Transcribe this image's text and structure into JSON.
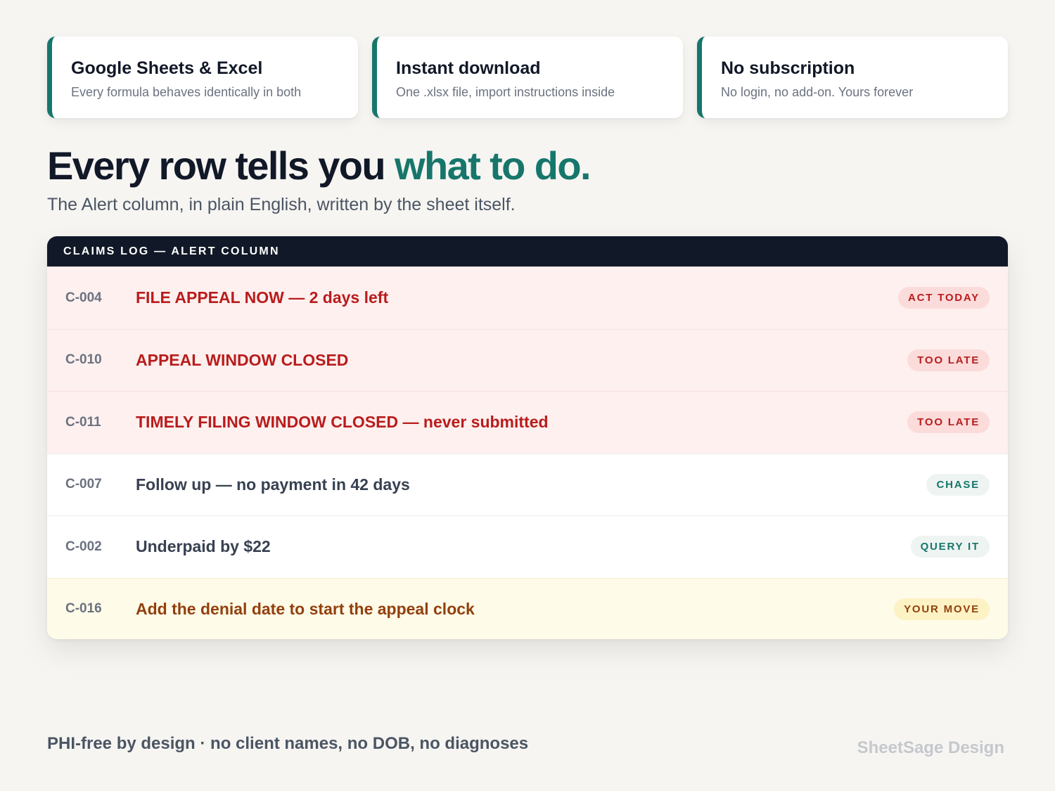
{
  "features": [
    {
      "title": "Google Sheets & Excel",
      "subtitle": "Every formula behaves identically in both"
    },
    {
      "title": "Instant download",
      "subtitle": "One .xlsx file, import instructions inside"
    },
    {
      "title": "No subscription",
      "subtitle": "No login, no add-on. Yours forever"
    }
  ],
  "headline": {
    "lead": "Every row tells you ",
    "accent": "what to do."
  },
  "subheadline": "The Alert column, in plain English, written by the sheet itself.",
  "table": {
    "header": "CLAIMS LOG — ALERT COLUMN",
    "rows": [
      {
        "id": "C-004",
        "message": "FILE APPEAL NOW — 2 days left",
        "badge": "ACT TODAY",
        "status": "danger"
      },
      {
        "id": "C-010",
        "message": "APPEAL WINDOW CLOSED",
        "badge": "TOO LATE",
        "status": "danger"
      },
      {
        "id": "C-011",
        "message": "TIMELY FILING WINDOW CLOSED — never submitted",
        "badge": "TOO LATE",
        "status": "danger"
      },
      {
        "id": "C-007",
        "message": "Follow up — no payment in 42 days",
        "badge": "CHASE",
        "status": "normal"
      },
      {
        "id": "C-002",
        "message": "Underpaid by $22",
        "badge": "QUERY IT",
        "status": "normal"
      },
      {
        "id": "C-016",
        "message": "Add the denial date to start the appeal clock",
        "badge": "YOUR MOVE",
        "status": "pending"
      }
    ]
  },
  "footer": {
    "note": "PHI-free by design · no client names, no DOB, no diagnoses",
    "brand": "SheetSage Design"
  },
  "colors": {
    "accent": "#17766b",
    "danger": "#b91c1c",
    "pending": "#92400e",
    "header_bg": "#111827"
  }
}
